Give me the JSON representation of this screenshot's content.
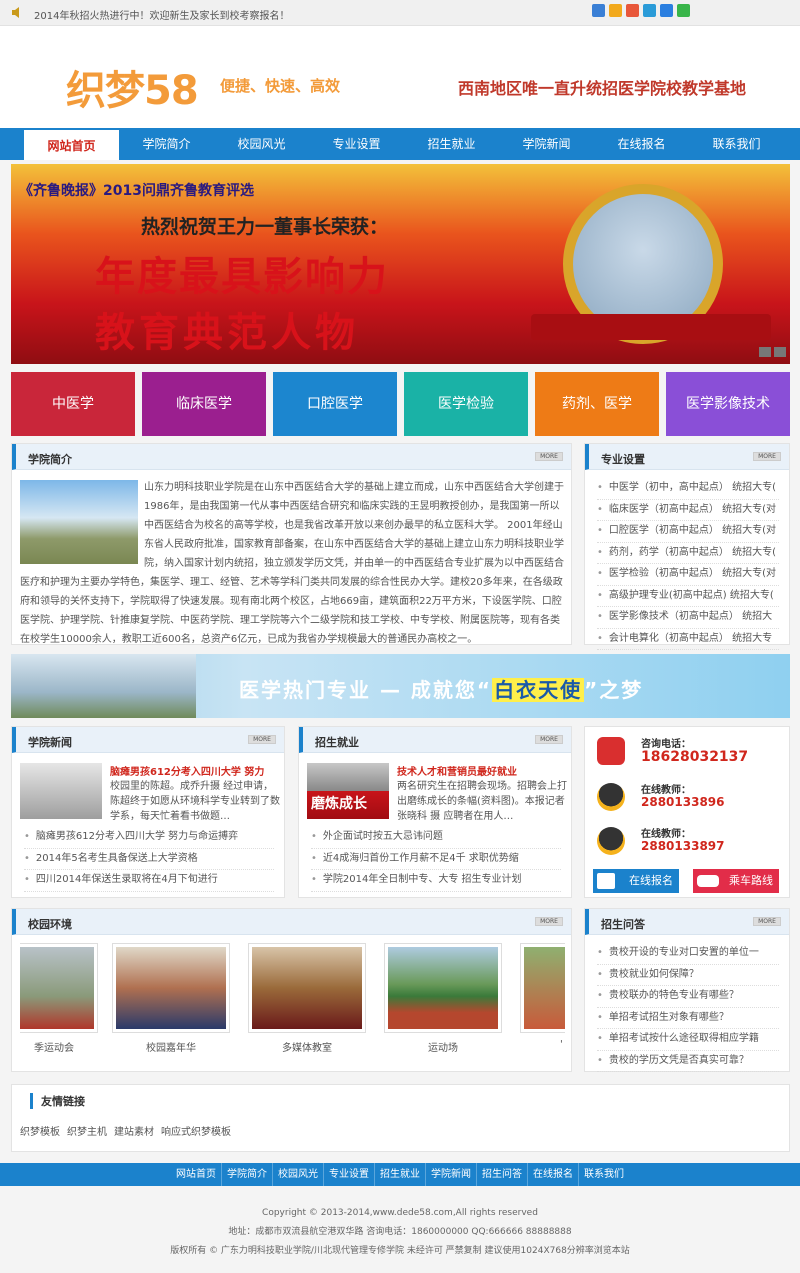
{
  "topbar": {
    "notice": "2014年秋招火热进行中！欢迎新生及家长到校考察报名！",
    "share_colors": [
      "#3a7fd5",
      "#f2a91c",
      "#e8573a",
      "#2a9bd8",
      "#2b7fe0",
      "#39b54a"
    ]
  },
  "header": {
    "logo": "织梦58",
    "slogan": "便捷、快速、高效",
    "right_text": "西南地区唯一直升统招医学院校教学基地"
  },
  "nav": {
    "items": [
      "网站首页",
      "学院简介",
      "校园风光",
      "专业设置",
      "招生就业",
      "学院新闻",
      "在线报名",
      "联系我们"
    ]
  },
  "banner": {
    "line1": "《齐鲁晚报》2013问鼎齐鲁教育评选",
    "line2": "热烈祝贺王力一董事长荣获：",
    "line3": "年度最具影响力",
    "line4": "教育典范人物"
  },
  "tiles": [
    {
      "label": "中医学",
      "color": "#c9263a"
    },
    {
      "label": "临床医学",
      "color": "#9b1f8f"
    },
    {
      "label": "口腔医学",
      "color": "#1c86cf"
    },
    {
      "label": "医学检验",
      "color": "#1ab2a6"
    },
    {
      "label": "药剂、医学",
      "color": "#ee7b16"
    },
    {
      "label": "医学影像技术",
      "color": "#8a4fd7"
    }
  ],
  "more": "MORE",
  "intro": {
    "title": "学院简介",
    "text": "山东力明科技职业学院是在山东中西医结合大学的基础上建立而成，山东中西医结合大学创建于1986年，是由我国第一代从事中西医结合研究和临床实践的王昱明教授创办，是我国第一所以中西医结合为校名的高等学校，也是我省改革开放以来创办最早的私立医科大学。 2001年经山东省人民政府批准，国家教育部备案，在山东中西医结合大学的基础上建立山东力明科技职业学院，纳入国家计划内统招，独立颁发学历文凭，并由单一的中西医结合专业扩展为以中西医结合医疗和护理为主要办学特色，集医学、理工、经管、艺术等学科门类共同发展的综合性民办大学。建校20多年来，在各级政府和领导的关怀支持下，学院取得了快速发展。现有南北两个校区，占地669亩，建筑面积22万平方米，下设医学院、口腔医学院、护理学院、针推康复学院、中医药学院、理工学院等六个二级学院和技工学校、中专学校、附属医院等，现有各类在校学生10000余人，教职工近600名，总资产6亿元，已成为我省办学规模最大的普通民办高校之一。"
  },
  "majors": {
    "title": "专业设置",
    "items": [
      "中医学（初中，高中起点） 统招大专(",
      "临床医学（初高中起点） 统招大专(对",
      "口腔医学（初高中起点） 统招大专(对",
      "药剂，药学（初高中起点） 统招大专(",
      "医学检验（初高中起点） 统招大专(对",
      "高级护理专业(初高中起点) 统招大专(",
      "医学影像技术（初高中起点） 统招大",
      "会计电算化（初高中起点） 统招大专"
    ]
  },
  "ad": {
    "text_a": "医学热门专业 — 成就您“",
    "text_b": "白衣天使",
    "text_c": "”之梦"
  },
  "news": {
    "title": "学院新闻",
    "feature_title": "脑瘫男孩612分考入四川大学 努力",
    "feature_desc": "校园里的陈超。成乔升摄 经过申请，陈超终于如愿从环境科学专业转到了数学系，每天忙着看书做题…",
    "items": [
      "脑瘫男孩612分考入四川大学 努力与命运搏弈",
      "2014年5名考生具备保送上大学资格",
      "四川2014年保送生录取将在4月下旬进行"
    ]
  },
  "jobs": {
    "title": "招生就业",
    "feature_title": "技术人才和营销员最好就业",
    "feature_desc": "两名研究生在招聘会现场。招聘会上打出磨练成长的条幅(资料图)。本报记者 张晓科 摄 应聘者在用人…",
    "feature_img_text": "磨炼成长",
    "items": [
      "外企面试时按五大忌讳问题",
      "近4成海归首份工作月薪不足4千 求职优势缩",
      "学院2014年全日制中专、大专 招生专业计划"
    ]
  },
  "contact": {
    "phone_label": "咨询电话：",
    "phone": "18628032137",
    "t1_label": "在线教师：",
    "t1": "2880133896",
    "t2_label": "在线教师：",
    "t2": "2880133897",
    "btn1": "在线报名",
    "btn2": "乘车路线"
  },
  "campus": {
    "title": "校园环境",
    "items": [
      "季运动会",
      "校园嘉年华",
      "多媒体教室",
      "运动场",
      "'"
    ]
  },
  "faq": {
    "title": "招生问答",
    "items": [
      "贵校开设的专业对口安置的单位一",
      "贵校就业如何保障？",
      "贵校联办的特色专业有哪些？",
      "单招考试招生对象有哪些？",
      "单招考试按什么途径取得相应学籍",
      "贵校的学历文凭是否真实可靠？"
    ]
  },
  "friend": {
    "title": "友情链接",
    "links": [
      "织梦模板",
      "织梦主机",
      "建站素材",
      "响应式织梦模板"
    ]
  },
  "foot_nav": [
    "网站首页",
    "学院简介",
    "校园风光",
    "专业设置",
    "招生就业",
    "学院新闻",
    "招生问答",
    "在线报名",
    "联系我们"
  ],
  "footer": {
    "copyright": "Copyright © 2013-2014,www.dede58.com,All rights reserved",
    "address": "地址：成都市双流县航空港双华路 咨询电话：1860000000 QQ:666666 88888888",
    "rights": "版权所有 © 广东力明科技职业学院/川北现代管理专修学院 未经许可 严禁复制 建议使用1024X768分辨率浏览本站"
  }
}
